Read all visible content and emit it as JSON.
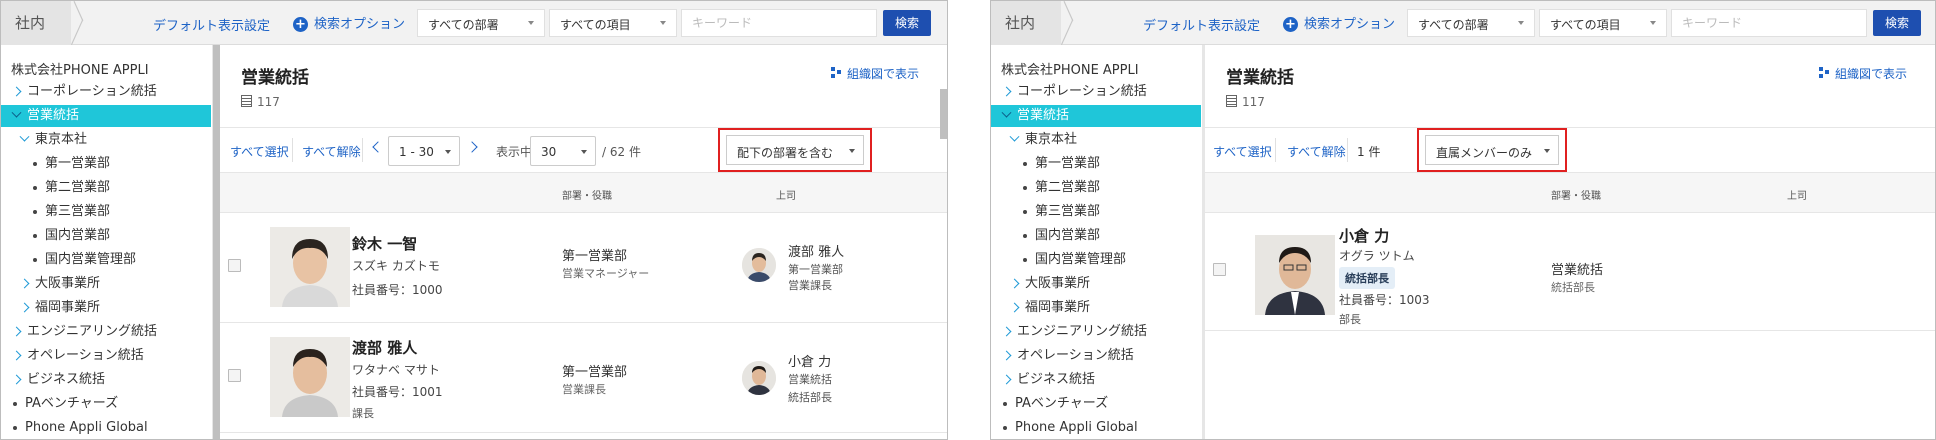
{
  "colors": {
    "accent": "#1e63c6",
    "active_row": "#1fc6d9",
    "search_button": "#1e4fb0",
    "highlight": "#e02020"
  },
  "icons": [
    "plus-circle-icon",
    "caret-down-icon",
    "chevron-right-icon",
    "chevron-down-icon",
    "org-chart-icon",
    "building-icon",
    "chevron-left-icon"
  ],
  "topbar": {
    "breadcrumb": "社内",
    "default_link": "デフォルト表示設定",
    "search_options": "検索オプション",
    "dept_select": "すべての部署",
    "item_select": "すべての項目",
    "keyword_placeholder": "キーワード",
    "search_button": "検索"
  },
  "sidebar": {
    "company": "株式会社PHONE APPLI",
    "items": [
      {
        "label": "コーポレーション統括"
      },
      {
        "label": "営業統括"
      },
      {
        "label": "東京本社"
      },
      {
        "label": "第一営業部"
      },
      {
        "label": "第二営業部"
      },
      {
        "label": "第三営業部"
      },
      {
        "label": "国内営業部"
      },
      {
        "label": "国内営業管理部"
      },
      {
        "label": "大阪事業所"
      },
      {
        "label": "福岡事業所"
      },
      {
        "label": "エンジニアリング統括"
      },
      {
        "label": "オペレーション統括"
      },
      {
        "label": "ビジネス統括"
      },
      {
        "label": "PAベンチャーズ"
      },
      {
        "label": "Phone Appli Global"
      }
    ]
  },
  "main": {
    "title": "営業統括",
    "org_link": "組織図で表示",
    "member_count": "117",
    "columns": {
      "dept": "部署・役職",
      "boss": "上司"
    }
  },
  "left": {
    "select_all": "すべて選択",
    "deselect_all": "すべて解除",
    "range": "1 - 30",
    "showing_label": "表示中",
    "page_size": "30",
    "total": "/ 62 件",
    "filter": "配下の部署を含む",
    "people": [
      {
        "name": "鈴木 一智",
        "kana": "スズキ カズトモ",
        "emp_no": "社員番号：1000",
        "dept": "第一営業部",
        "role": "営業マネージャー",
        "boss_name": "渡部 雅人",
        "boss_dept": "第一営業部",
        "boss_role": "営業課長"
      },
      {
        "name": "渡部 雅人",
        "kana": "ワタナベ マサト",
        "emp_no": "社員番号：1001",
        "title": "課長",
        "dept": "第一営業部",
        "role": "営業課長",
        "boss_name": "小倉 力",
        "boss_dept": "営業統括",
        "boss_role": "統括部長"
      }
    ]
  },
  "right": {
    "select_all": "すべて選択",
    "deselect_all": "すべて解除",
    "total": "1 件",
    "filter": "直属メンバーのみ",
    "people": [
      {
        "name": "小倉 力",
        "kana": "オグラ ツトム",
        "badge": "統括部長",
        "emp_no": "社員番号：1003",
        "title": "部長",
        "dept": "営業統括",
        "role": "統括部長"
      }
    ]
  }
}
